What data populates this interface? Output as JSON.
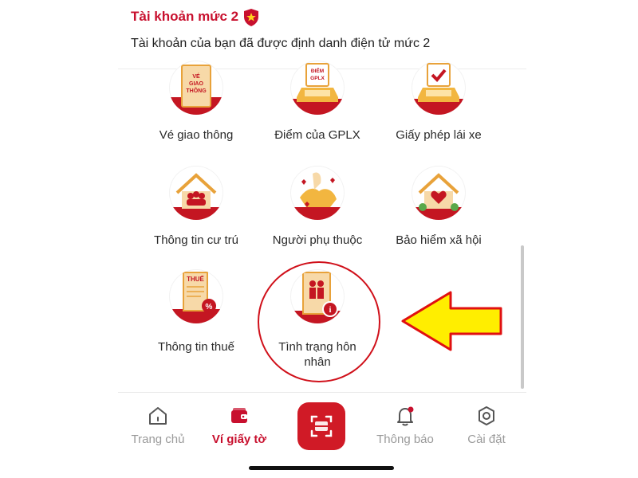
{
  "account": {
    "title": "Tài khoản mức 2",
    "description": "Tài khoản của bạn đã được định danh điện tử mức 2"
  },
  "services": [
    {
      "label": "Vé giao thông",
      "icon_text": [
        "VÉ",
        "GIAO",
        "THÔNG"
      ]
    },
    {
      "label": "Điểm của GPLX",
      "icon_text": [
        "ĐIỂM",
        "GPLX"
      ]
    },
    {
      "label": "Giấy phép lái xe"
    },
    {
      "label": "Thông tin cư trú"
    },
    {
      "label": "Người phụ thuộc"
    },
    {
      "label": "Bảo hiểm xã hội"
    },
    {
      "label": "Thông tin thuế",
      "icon_text": [
        "THUẾ"
      ]
    },
    {
      "label_line1": "Tình trạng hôn",
      "label_line2": "nhân"
    }
  ],
  "tabs": [
    {
      "label": "Trang chủ",
      "icon": "home-icon"
    },
    {
      "label": "Ví giấy tờ",
      "icon": "wallet-icon",
      "active": true
    },
    {
      "label": "",
      "icon": "scan-icon"
    },
    {
      "label": "Thông báo",
      "icon": "bell-icon"
    },
    {
      "label": "Cài đặt",
      "icon": "settings-icon"
    }
  ],
  "colors": {
    "brand_red": "#c8102e",
    "highlight_arrow": "#ffee00",
    "inactive_tab": "#9a9a9a"
  }
}
